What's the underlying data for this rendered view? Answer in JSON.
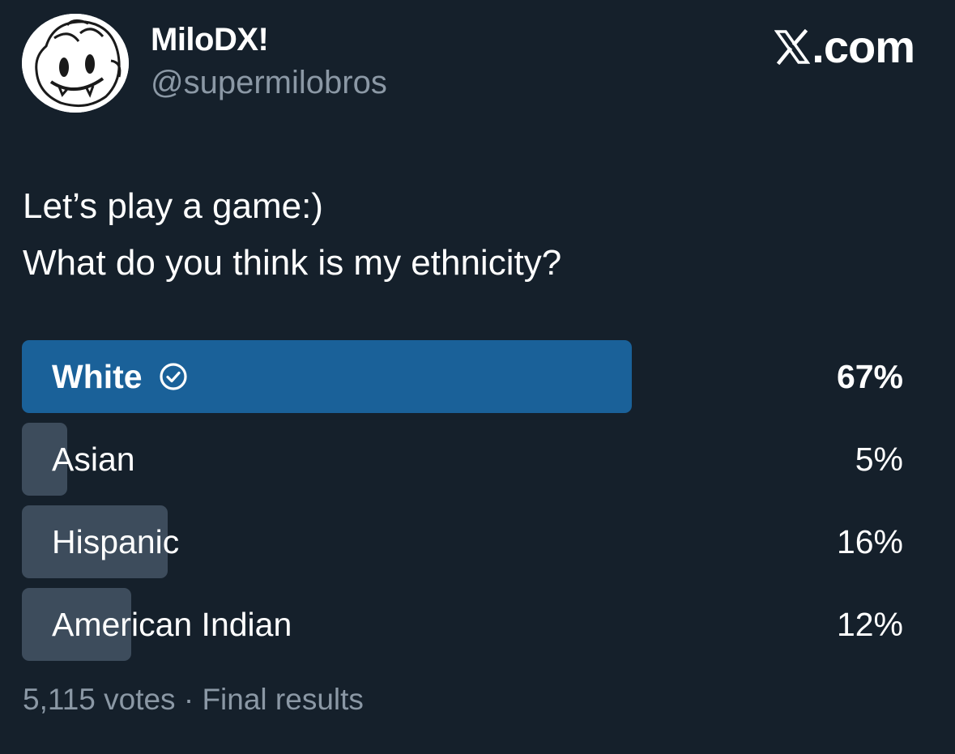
{
  "author": {
    "display_name": "MiloDX!",
    "handle": "@supermilobros",
    "avatar_icon": "cartoon-face-avatar"
  },
  "brand": {
    "logo_icon": "x-logo-icon",
    "domain_suffix": ".com"
  },
  "tweet": {
    "lines": [
      "Let’s play a game:)",
      "What do you think is my ethnicity?"
    ]
  },
  "poll": {
    "options": [
      {
        "label": "White",
        "percent_label": "67%",
        "percent": 67,
        "winner": true,
        "icon": "check-circle-icon"
      },
      {
        "label": "Asian",
        "percent_label": "5%",
        "percent": 5,
        "winner": false
      },
      {
        "label": "Hispanic",
        "percent_label": "16%",
        "percent": 16,
        "winner": false
      },
      {
        "label": "American Indian",
        "percent_label": "12%",
        "percent": 12,
        "winner": false
      }
    ],
    "votes": "5,115 votes",
    "separator": "·",
    "status": "Final results"
  },
  "colors": {
    "background": "#15202b",
    "winner_bar": "#1a6199",
    "bar": "#3d4c5c",
    "muted_text": "#8b98a5",
    "text": "#ffffff"
  }
}
